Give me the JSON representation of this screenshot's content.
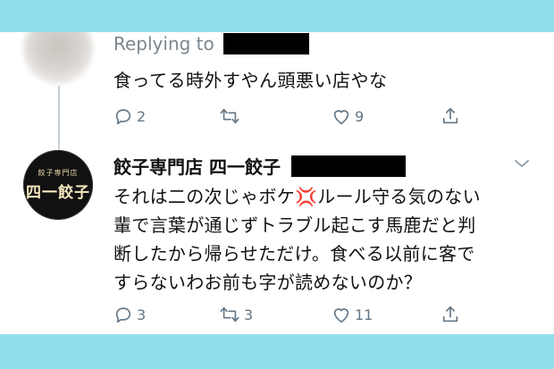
{
  "tweet1": {
    "replying_label": "Replying to",
    "text": "食ってる時外すやん頭悪い店やな",
    "reply_count": "2",
    "retweet_count": "",
    "like_count": "9"
  },
  "tweet2": {
    "author_name": "餃子専門店 四一餃子",
    "avatar_text_small": "餃子専門店",
    "avatar_text_big": "四一餃子",
    "lines": [
      "それは二の次じゃボケ💢ルール守る気のない",
      "輩で言葉が通じずトラブル起こす馬鹿だと判",
      "断したから帰らせただけ。食べる以前に客で",
      "すらないわお前も字が読めないのか？"
    ],
    "reply_count": "3",
    "retweet_count": "3",
    "like_count": "11"
  },
  "colors": {
    "background": "#8fe0ec",
    "card": "#ffffff",
    "icon_gray": "#657786",
    "anger_red": "#e0245e"
  },
  "icons": [
    "reply-icon",
    "retweet-icon",
    "like-icon",
    "share-icon",
    "chevron-down-icon",
    "anger-symbol-icon"
  ]
}
